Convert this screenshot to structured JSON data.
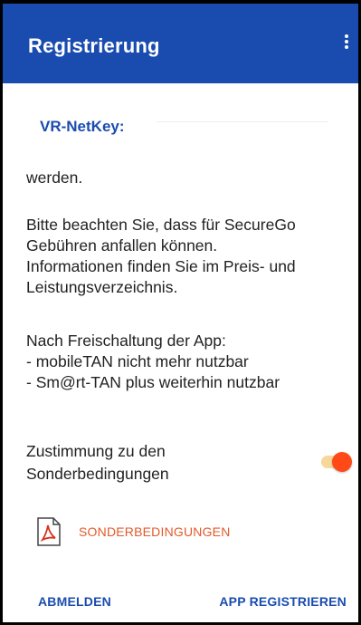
{
  "appbar": {
    "title": "Registrierung",
    "overflow_icon": "more-vert-icon"
  },
  "field": {
    "label": "VR-NetKey:",
    "value": ""
  },
  "body": {
    "partial_line": "werden.",
    "paragraph1": [
      "Bitte beachten Sie, dass für SecureGo",
      "Gebühren anfallen können.",
      "Informationen finden Sie im Preis- und",
      "Leistungsverzeichnis."
    ],
    "paragraph2": [
      "Nach Freischaltung der App:",
      "- mobileTAN nicht mehr nutzbar",
      "- Sm@rt-TAN plus weiterhin nutzbar"
    ]
  },
  "consent": {
    "label_line1": "Zustimmung zu den",
    "label_line2": "Sonderbedingungen",
    "checked": true,
    "toggle_color": "#ff4a17"
  },
  "document": {
    "icon": "pdf-icon",
    "label": "SONDERBEDINGUNGEN",
    "color": "#e25a2a"
  },
  "footer": {
    "logout_label": "ABMELDEN",
    "register_label": "APP REGISTRIEREN"
  },
  "colors": {
    "primary": "#1a4cb0",
    "accent": "#ff4a17"
  }
}
